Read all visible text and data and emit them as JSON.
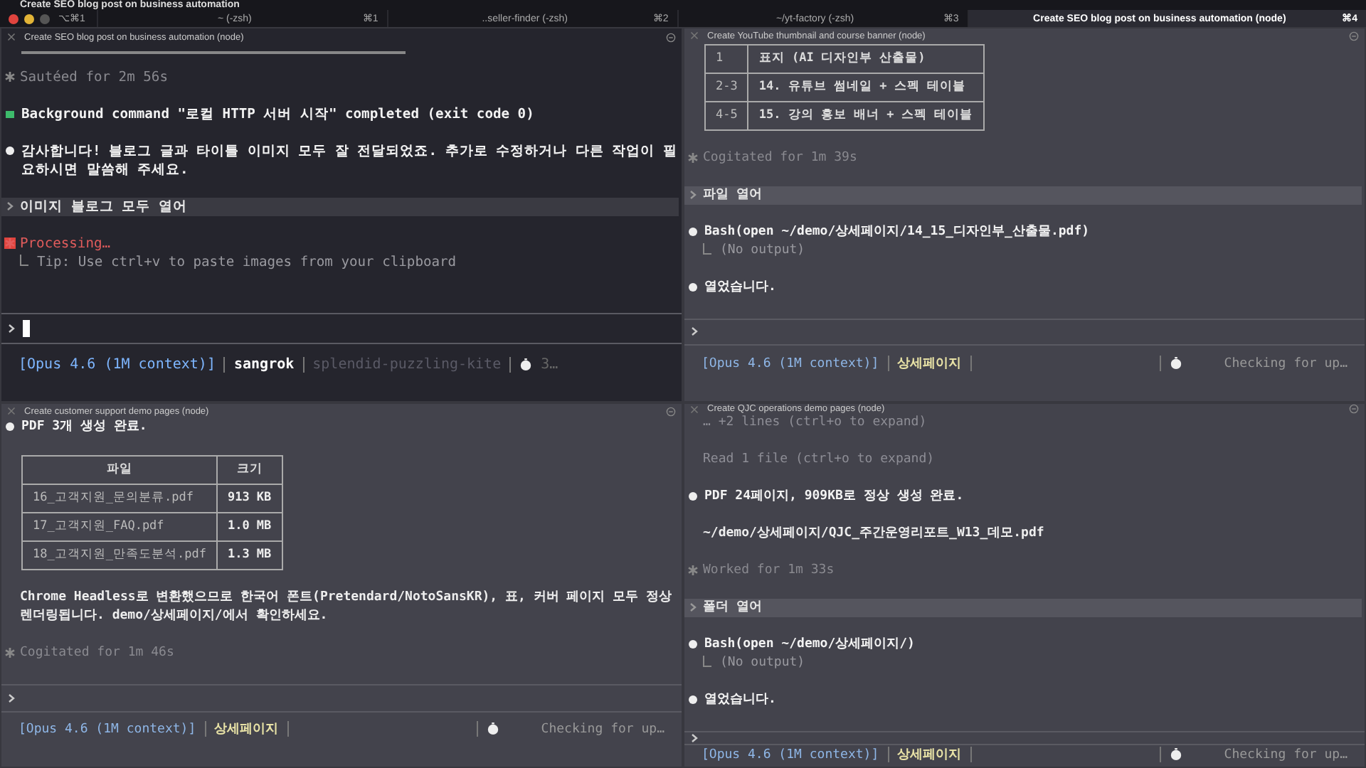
{
  "window": {
    "title": "Create SEO blog post on business automation",
    "shortcut": "⌥⌘1"
  },
  "tabs": [
    {
      "label": "~ (-zsh)",
      "shortcut": "⌘1",
      "selected": false
    },
    {
      "label": "..seller-finder (-zsh)",
      "shortcut": "⌘2",
      "selected": false
    },
    {
      "label": "~/yt-factory (-zsh)",
      "shortcut": "⌘3",
      "selected": false
    },
    {
      "label": "Create SEO blog post on business automation (node)",
      "shortcut": "⌘4",
      "selected": true
    }
  ],
  "panes": [
    {
      "title": "Create SEO blog post on business automation (node)",
      "focused": true,
      "lines": [
        {
          "kind": "rule"
        },
        {
          "kind": "status",
          "text": "Sautéed for 2m 56s"
        },
        {
          "kind": "notice",
          "text": "Background command \"로컬 HTTP 서버 시작\" completed (exit code 0)"
        },
        {
          "kind": "message",
          "text": "감사합니다! 블로그 글과 타이틀 이미지 모두 잘 전달되었죠. 추가로 수정하거나 다른 작업이 필요하시면 말씀해 주세요."
        },
        {
          "kind": "prompt",
          "text": "이미지 블로그 모두 열어"
        },
        {
          "kind": "processing",
          "text": "Processing…"
        },
        {
          "kind": "output",
          "text": "Tip: Use ctrl+v to paste images from your clipboard"
        }
      ],
      "status": {
        "model": "[Opus 4.6 (1M context)]",
        "segments": [
          "sangrok",
          "splendid-puzzling-kite"
        ],
        "trailing": "3…"
      }
    },
    {
      "title": "Create YouTube thumbnail and course banner (node)",
      "focused": false,
      "lines": [
        {
          "kind": "table",
          "rows": [
            [
              "1",
              "표지 (AI 디자인부 산출물)"
            ],
            [
              "2-3",
              "14. 유튜브 썸네일 + 스펙 테이블"
            ],
            [
              "4-5",
              "15. 강의 홍보 배너 + 스펙 테이블"
            ]
          ]
        },
        {
          "kind": "status",
          "text": "Cogitated for 1m 39s"
        },
        {
          "kind": "prompt",
          "text": "파일 열어"
        },
        {
          "kind": "tool",
          "text": "Bash(open ~/demo/상세페이지/14_15_디자인부_산출물.pdf)"
        },
        {
          "kind": "output",
          "text": "(No output)"
        },
        {
          "kind": "message",
          "text": "열었습니다."
        }
      ],
      "status": {
        "model": "[Opus 4.6 (1M context)]",
        "segments": [
          "상세페이지"
        ],
        "trailing": "Checking for up…"
      }
    },
    {
      "title": "Create customer support demo pages (node)",
      "focused": false,
      "lines": [
        {
          "kind": "message",
          "text": "PDF 3개 생성 완료."
        },
        {
          "kind": "table",
          "header": [
            "파일",
            "크기"
          ],
          "rows": [
            [
              "16_고객지원_문의분류.pdf",
              "913 KB"
            ],
            [
              "17_고객지원_FAQ.pdf",
              "1.0 MB"
            ],
            [
              "18_고객지원_만족도분석.pdf",
              "1.3 MB"
            ]
          ]
        },
        {
          "kind": "text",
          "text": "Chrome Headless로 변환했으므로 한국어 폰트(Pretendard/NotoSansKR), 표, 커버 페이지 모두 정상 렌더링됩니다. demo/상세페이지/에서 확인하세요."
        },
        {
          "kind": "status",
          "text": "Cogitated for 1m 46s"
        }
      ],
      "status": {
        "model": "[Opus 4.6 (1M context)]",
        "segments": [
          "상세페이지"
        ],
        "trailing": "Checking for up…"
      }
    },
    {
      "title": "Create QJC operations demo pages (node)",
      "focused": false,
      "lines": [
        {
          "kind": "dim",
          "text": "… +2 lines (ctrl+o to expand)"
        },
        {
          "kind": "dim",
          "text": "Read 1 file (ctrl+o to expand)"
        },
        {
          "kind": "message",
          "text": "PDF 24페이지, 909KB로 정상 생성 완료."
        },
        {
          "kind": "text",
          "text": "~/demo/상세페이지/QJC_주간운영리포트_W13_데모.pdf"
        },
        {
          "kind": "status",
          "text": "Worked for 1m 33s"
        },
        {
          "kind": "prompt",
          "text": "폴더 열어"
        },
        {
          "kind": "tool",
          "text": "Bash(open ~/demo/상세페이지/)"
        },
        {
          "kind": "output",
          "text": "(No output)"
        },
        {
          "kind": "message",
          "text": "열었습니다."
        }
      ],
      "status": {
        "model": "[Opus 4.6 (1M context)]",
        "segments": [
          "상세페이지"
        ],
        "trailing": "Checking for up…"
      }
    }
  ]
}
